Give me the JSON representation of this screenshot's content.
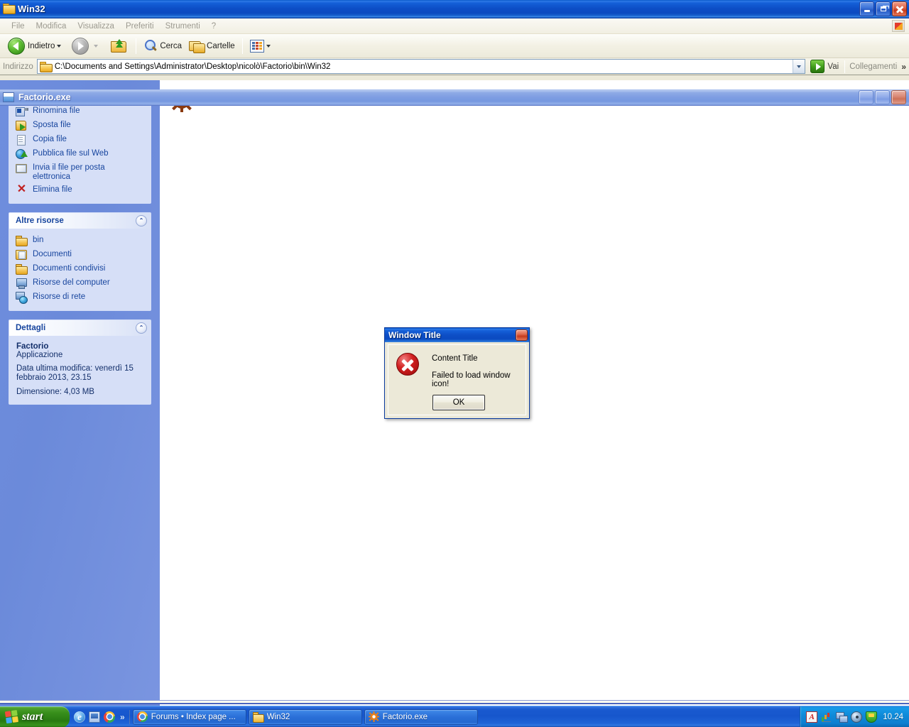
{
  "explorer": {
    "title": "Win32",
    "title_icon": "folder-icon",
    "menu": [
      "File",
      "Modifica",
      "Visualizza",
      "Preferiti",
      "Strumenti",
      "?"
    ],
    "toolbar": {
      "back_label": "Indietro",
      "forward_label": "",
      "up_label": "",
      "search_label": "Cerca",
      "folders_label": "Cartelle",
      "views_label": ""
    },
    "address": {
      "label": "Indirizzo",
      "value": "C:\\Documents and Settings\\Administrator\\Desktop\\nicolò\\Factorio\\bin\\Win32",
      "go_label": "Vai",
      "links_label": "Collegamenti",
      "overflow_label": "»"
    },
    "window_buttons": {
      "minimize": "_",
      "restore": "❐",
      "close": "✕"
    },
    "sidebar": {
      "file_tasks": {
        "items": [
          {
            "label": "Rinomina file",
            "icon": "rename-file-icon"
          },
          {
            "label": "Sposta file",
            "icon": "move-file-icon"
          },
          {
            "label": "Copia file",
            "icon": "copy-file-icon"
          },
          {
            "label": "Pubblica file sul Web",
            "icon": "publish-web-icon"
          },
          {
            "label": "Invia il file per posta elettronica",
            "icon": "email-file-icon"
          },
          {
            "label": "Elimina file",
            "icon": "delete-file-icon"
          }
        ]
      },
      "other_places": {
        "header": "Altre risorse",
        "collapse_glyph": "⌃",
        "items": [
          {
            "label": "bin",
            "icon": "folder-icon"
          },
          {
            "label": "Documenti",
            "icon": "documents-folder-icon"
          },
          {
            "label": "Documenti condivisi",
            "icon": "shared-documents-icon"
          },
          {
            "label": "Risorse del computer",
            "icon": "my-computer-icon"
          },
          {
            "label": "Risorse di rete",
            "icon": "network-places-icon"
          }
        ]
      },
      "details": {
        "header": "Dettagli",
        "collapse_glyph": "⌃",
        "name": "Factorio",
        "type": "Applicazione",
        "modified": "Data ultima modifica: venerdì 15 febbraio 2013, 23.15",
        "size": "Dimensione: 4,03 MB"
      }
    }
  },
  "factorio_window": {
    "title": "Factorio.exe",
    "icon": "generic-document-icon",
    "window_buttons": {
      "minimize": "_",
      "maximize": "□",
      "close": "✕"
    }
  },
  "dialog": {
    "title": "Window Title",
    "close_glyph": "✕",
    "icon": "error-icon",
    "content_title": "Content Title",
    "message": "Failed to load window icon!",
    "ok_label": "OK"
  },
  "taskbar": {
    "start_label": "start",
    "start_icon": "windows-flag-icon",
    "quick_launch": [
      {
        "icon": "internet-explorer-icon"
      },
      {
        "icon": "show-desktop-icon"
      },
      {
        "icon": "chrome-icon"
      }
    ],
    "quick_launch_overflow": "»",
    "buttons": [
      {
        "label": "Forums • Index page ...",
        "icon": "chrome-icon"
      },
      {
        "label": "Win32",
        "icon": "folder-icon"
      },
      {
        "label": "Factorio.exe",
        "icon": "gear-icon"
      }
    ],
    "tray": {
      "icons": [
        "acrobat-icon",
        "bar-chart-icon",
        "network-connection-icon",
        "disc-drive-icon",
        "security-shield-icon"
      ],
      "clock": "10.24"
    }
  },
  "colors": {
    "titlebar_blue": "#0d4ec6",
    "sidebar_blue": "#6a87da",
    "panel_fill": "#d6dff7",
    "link_blue": "#17459e",
    "taskbar_blue": "#1656cc",
    "start_green": "#2f8416",
    "error_red": "#d22020",
    "dialog_face": "#ece9d8"
  }
}
